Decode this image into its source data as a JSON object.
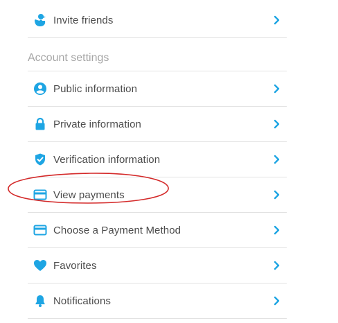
{
  "colors": {
    "accent": "#1ea5e3",
    "text": "#4b4b4b",
    "section": "#a6a6a6",
    "annotation": "#d42a2a"
  },
  "top_item": {
    "label": "Invite friends",
    "icon": "duck-icon"
  },
  "account": {
    "title": "Account settings",
    "items": [
      {
        "label": "Public information",
        "icon": "user-circle-icon"
      },
      {
        "label": "Private information",
        "icon": "lock-icon"
      },
      {
        "label": "Verification information",
        "icon": "shield-check-icon"
      },
      {
        "label": "View payments",
        "icon": "credit-card-icon"
      },
      {
        "label": "Choose a Payment Method",
        "icon": "credit-card-icon"
      },
      {
        "label": "Favorites",
        "icon": "heart-icon"
      },
      {
        "label": "Notifications",
        "icon": "bell-icon"
      }
    ]
  }
}
